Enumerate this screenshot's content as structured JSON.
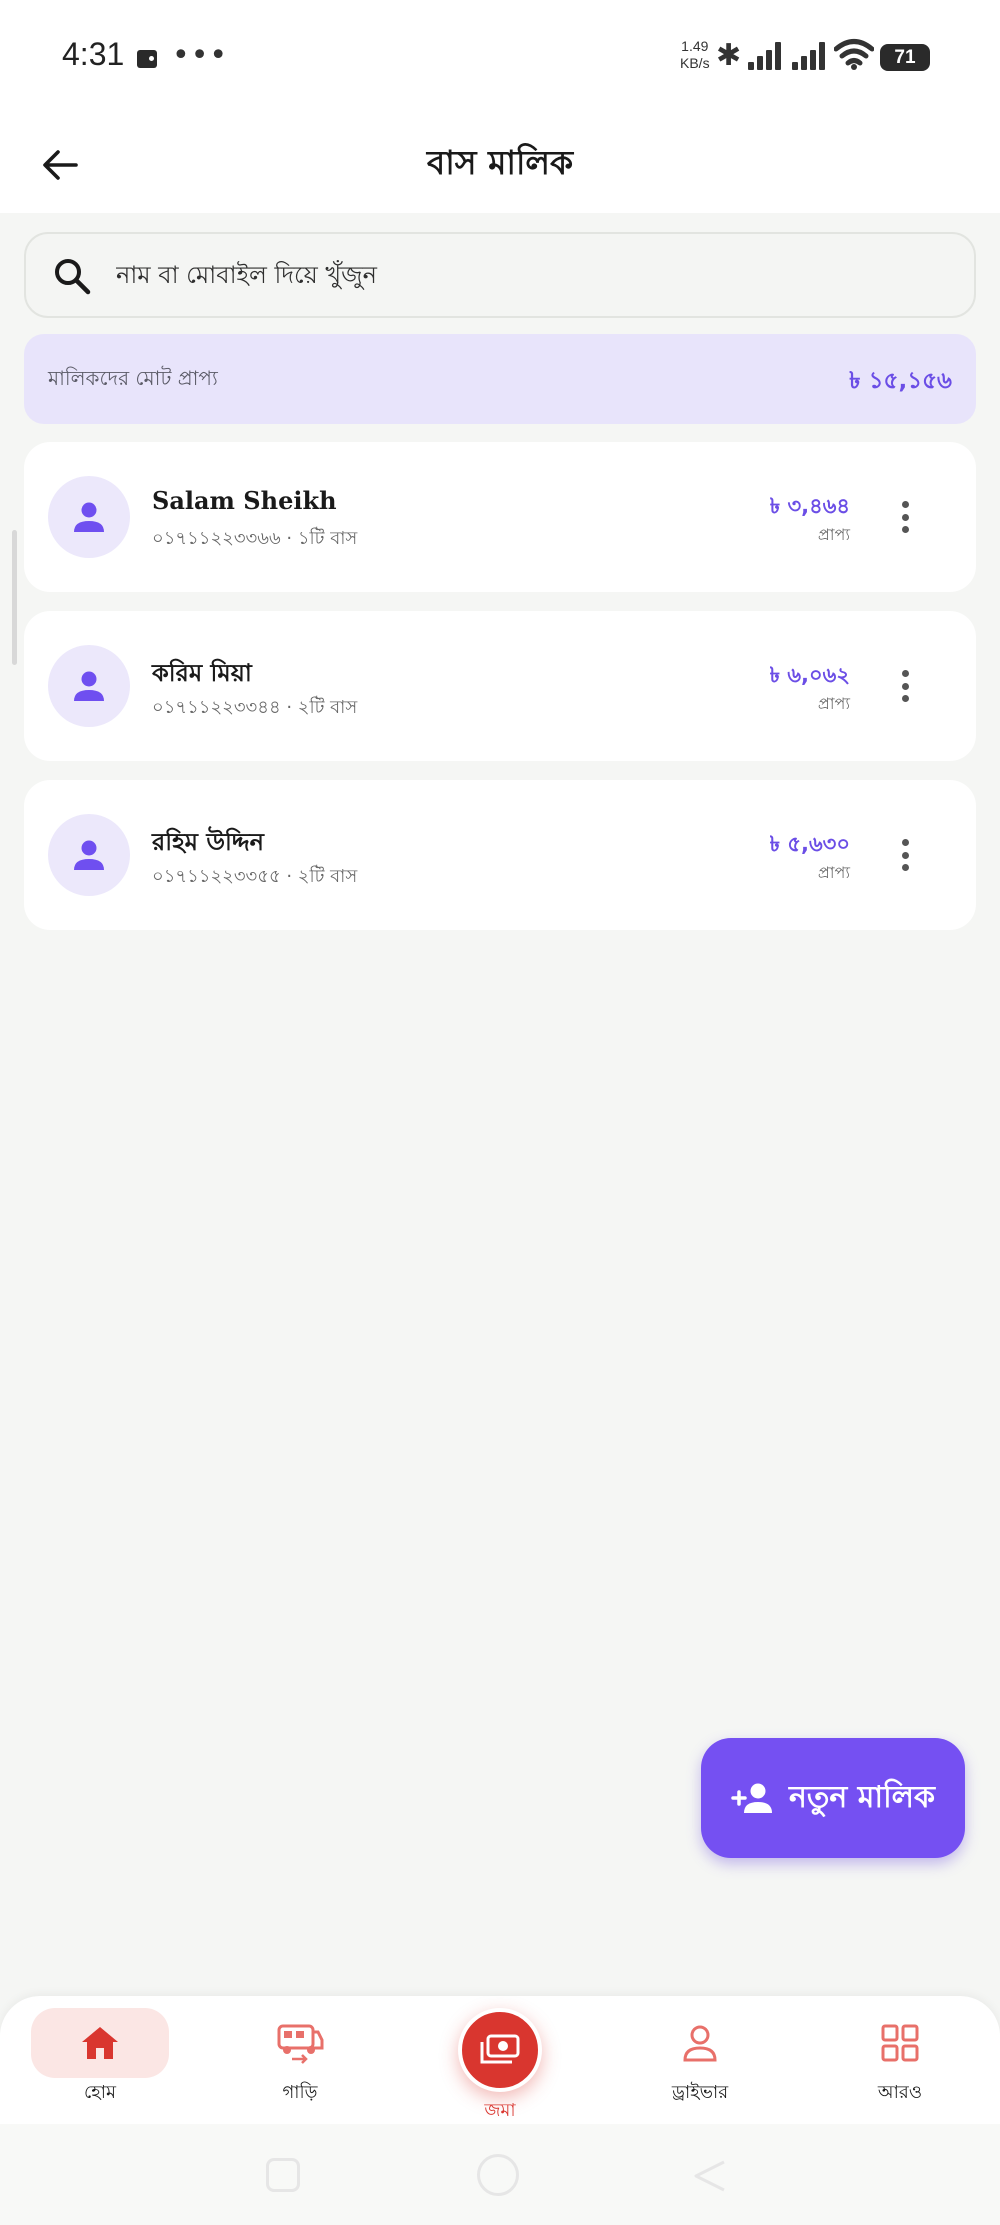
{
  "status_bar": {
    "time": "4:31",
    "net_speed_value": "1.49",
    "net_speed_unit": "KB/s",
    "battery": "71"
  },
  "header": {
    "title": "বাস মালিক"
  },
  "search": {
    "placeholder": "নাম বা মোবাইল দিয়ে খুঁজুন"
  },
  "summary": {
    "label": "মালিকদের মোট প্রাপ্য",
    "value": "৳ ১৫,১৫৬"
  },
  "owners": [
    {
      "name": "Salam Sheikh",
      "subtitle": "০১৭১১২২৩৩৬৬ · ১টি বাস",
      "amount": "৳ ৩,৪৬৪",
      "amount_caption": "প্রাপ্য"
    },
    {
      "name": "করিম মিয়া",
      "subtitle": "০১৭১১২২৩৩৪৪ · ২টি বাস",
      "amount": "৳ ৬,০৬২",
      "amount_caption": "প্রাপ্য"
    },
    {
      "name": "রহিম উদ্দিন",
      "subtitle": "০১৭১১২২৩৩৫৫ · ২টি বাস",
      "amount": "৳ ৫,৬৩০",
      "amount_caption": "প্রাপ্য"
    }
  ],
  "fab": {
    "label": "নতুন মালিক"
  },
  "bottom_nav": {
    "items": [
      {
        "label": "হোম",
        "icon": "home-icon"
      },
      {
        "label": "গাড়ি",
        "icon": "bus-icon"
      },
      {
        "label": "জমা",
        "icon": "deposit-icon"
      },
      {
        "label": "ড্রাইভার",
        "icon": "driver-icon"
      },
      {
        "label": "আরও",
        "icon": "grid-icon"
      }
    ]
  },
  "colors": {
    "accent": "#7550f2",
    "amount": "#6b4ee6",
    "nav_active": "#d9362f",
    "summary_bg": "#e8e4fb"
  }
}
